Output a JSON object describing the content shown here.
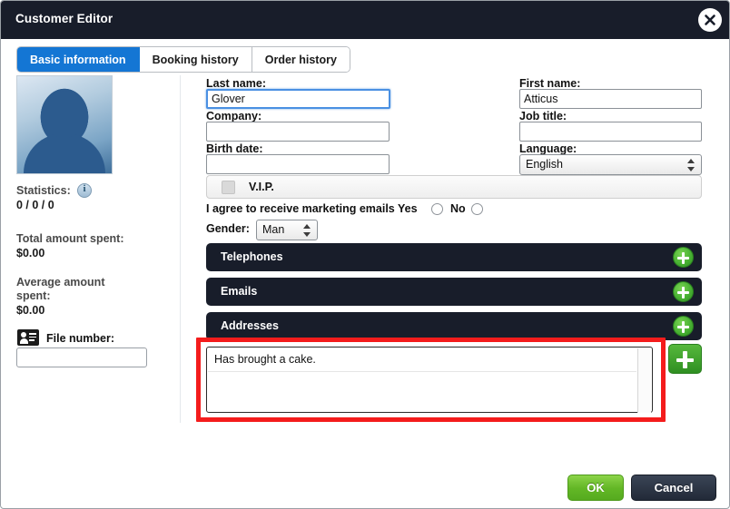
{
  "window": {
    "title": "Customer Editor",
    "close_icon": "close-icon"
  },
  "tabs": [
    {
      "label": "Basic information",
      "active": true
    },
    {
      "label": "Booking history",
      "active": false
    },
    {
      "label": "Order history",
      "active": false
    }
  ],
  "sidebar": {
    "avatar_icon": "avatar-placeholder-icon",
    "statistics_label": "Statistics:",
    "statistics_info_icon": "info-icon",
    "statistics_value": "0 / 0 / 0",
    "total_spent_label": "Total amount spent:",
    "total_spent_value": "$0.00",
    "average_spent_label": "Average amount spent:",
    "average_spent_line1": "Average amount",
    "average_spent_line2": "spent:",
    "average_spent_value": "$0.00",
    "file_number_icon": "id-card-icon",
    "file_number_label": "File number:",
    "file_number_value": "",
    "file_number_placeholder": ""
  },
  "form": {
    "last_name": {
      "label": "Last name:",
      "value": "Glover",
      "placeholder": ""
    },
    "first_name": {
      "label": "First name:",
      "value": "Atticus",
      "placeholder": ""
    },
    "company": {
      "label": "Company:",
      "value": "",
      "placeholder": ""
    },
    "job_title": {
      "label": "Job title:",
      "value": "",
      "placeholder": ""
    },
    "birth_date": {
      "label": "Birth date:",
      "value": "",
      "placeholder": ""
    },
    "language": {
      "label": "Language:",
      "value": "English",
      "options": [
        "English"
      ]
    },
    "vip": {
      "label": "V.I.P.",
      "checked": false
    },
    "consent": {
      "text": "I agree to receive marketing emails",
      "yes_label": "Yes",
      "no_label": "No",
      "selected": ""
    },
    "gender": {
      "label": "Gender:",
      "value": "Man",
      "options": [
        "Man"
      ]
    }
  },
  "sections": [
    {
      "title": "Telephones",
      "add_icon": "plus-icon"
    },
    {
      "title": "Emails",
      "add_icon": "plus-icon"
    },
    {
      "title": "Addresses",
      "add_icon": "plus-icon"
    }
  ],
  "note": {
    "value": "Has brought a cake.",
    "placeholder": "",
    "add_icon": "plus-icon"
  },
  "footer": {
    "ok_label": "OK",
    "cancel_label": "Cancel"
  },
  "colors": {
    "titlebar": "#181d2a",
    "accent_blue": "#1476d4",
    "section_dark": "#181d2a",
    "green": "#49b233",
    "highlight_red": "#f41c1c"
  }
}
